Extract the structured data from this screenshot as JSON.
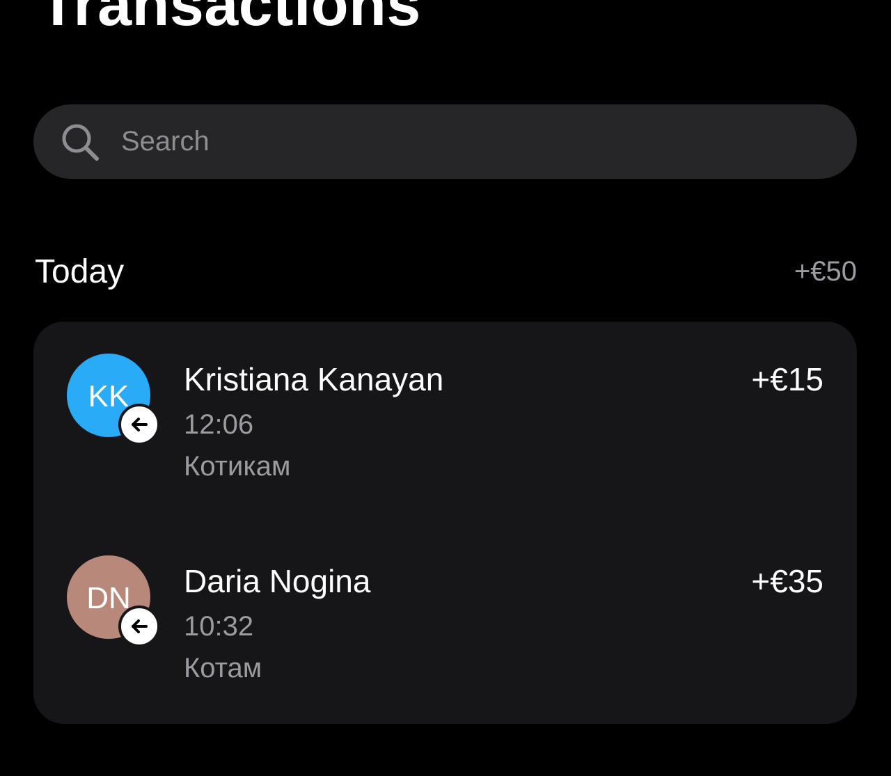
{
  "header": {
    "title": "Transactions"
  },
  "search": {
    "placeholder": "Search",
    "icon": "search-icon"
  },
  "section": {
    "title": "Today",
    "total": "+€50"
  },
  "transactions": [
    {
      "initials": "KK",
      "name": "Kristiana Kanayan",
      "time": "12:06",
      "note": "Котикам",
      "amount": "+€15",
      "avatar_color": "#2aabf8",
      "direction_icon": "arrow-left-icon"
    },
    {
      "initials": "DN",
      "name": "Daria Nogina",
      "time": "10:32",
      "note": "Котам",
      "amount": "+€35",
      "avatar_color": "#b8897a",
      "direction_icon": "arrow-left-icon"
    }
  ],
  "colors": {
    "background": "#000000",
    "surface": "#161618",
    "search_bg": "#262629",
    "secondary_text": "#9b9ba1"
  }
}
